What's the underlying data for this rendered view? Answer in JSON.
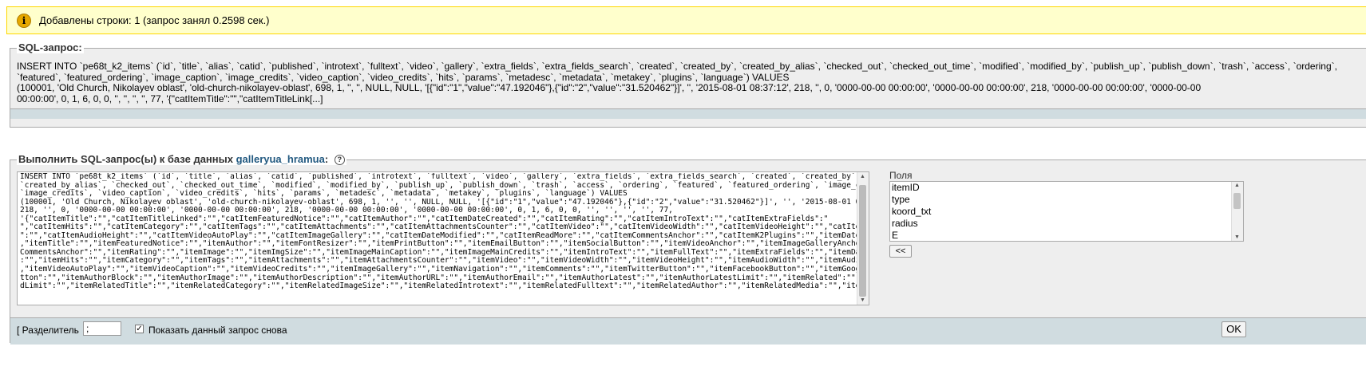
{
  "notice": {
    "icon": "info-icon",
    "icon_glyph": "i",
    "text": "Добавлены строки: 1 (запрос занял 0.2598 сек.)"
  },
  "sql_box": {
    "legend": "SQL-запрос:",
    "query": "INSERT INTO `pe68t_k2_items` (`id`, `title`, `alias`, `catid`, `published`, `introtext`, `fulltext`, `video`, `gallery`, `extra_fields`, `extra_fields_search`, `created`, `created_by`, `created_by_alias`, `checked_out`, `checked_out_time`, `modified`, `modified_by`, `publish_up`, `publish_down`, `trash`, `access`, `ordering`, `featured`, `featured_ordering`, `image_caption`, `image_credits`, `video_caption`, `video_credits`, `hits`, `params`, `metadesc`, `metadata`, `metakey`, `plugins`, `language`) VALUES\n(100001, 'Old Church, Nikolayev oblast', 'old-church-nikolayev-oblast', 698, 1, '', '', NULL, NULL, '[{\"id\":\"1\",\"value\":\"47.192046\"},{\"id\":\"2\",\"value\":\"31.520462\"}]', '', '2015-08-01 08:37:12', 218, '', 0, '0000-00-00 00:00:00', '0000-00-00 00:00:00', 218, '0000-00-00 00:00:00', '0000-00-00\n00:00:00', 0, 1, 6, 0, 0, '', '', '', '', 77, '{\"catItemTitle\":\"\",\"catItemTitleLink[...]"
  },
  "query_box": {
    "legend_prefix": "Выполнить SQL-запрос(ы) к базе данных ",
    "db_name": "galleryua_hramua",
    "legend_suffix": ":",
    "help_glyph": "?",
    "textarea_text": "INSERT INTO `pe68t_k2_items` (`id`, `title`, `alias`, `catid`, `published`, `introtext`, `fulltext`, `video`, `gallery`, `extra_fields`, `extra_fields_search`, `created`, `created_by`,\n`created_by_alias`, `checked_out`, `checked_out_time`, `modified`, `modified_by`, `publish_up`, `publish_down`, `trash`, `access`, `ordering`, `featured`, `featured_ordering`, `image_caption`,\n`image_credits`, `video_caption`, `video_credits`, `hits`, `params`, `metadesc`, `metadata`, `metakey`, `plugins`, `language`) VALUES\n(100001, 'Old Church, Nikolayev oblast', 'old-church-nikolayev-oblast', 698, 1, '', '', NULL, NULL, '[{\"id\":\"1\",\"value\":\"47.192046\"},{\"id\":\"2\",\"value\":\"31.520462\"}]', '', '2015-08-01 08:37:12',\n218, '', 0, '0000-00-00 00:00:00', '0000-00-00 00:00:00', 218, '0000-00-00 00:00:00', '0000-00-00 00:00:00', 0, 1, 6, 0, 0, '', '', '', '', 77,\n'{\"catItemTitle\":\"\",\"catItemTitleLinked\":\"\",\"catItemFeaturedNotice\":\"\",\"catItemAuthor\":\"\",\"catItemDateCreated\":\"\",\"catItemRating\":\"\",\"catItemIntroText\":\"\",\"catItemExtraFields\":\"\n\",\"catItemHits\":\"\",\"catItemCategory\":\"\",\"catItemTags\":\"\",\"catItemAttachments\":\"\",\"catItemAttachmentsCounter\":\"\",\"catItemVideo\":\"\",\"catItemVideoWidth\":\"\",\"catItemVideoHeight\":\"\",\"catItemAudioWidth\n\":\"\",\"catItemAudioHeight\":\"\",\"catItemVideoAutoPlay\":\"\",\"catItemImageGallery\":\"\",\"catItemDateModified\":\"\",\"catItemReadMore\":\"\",\"catItemCommentsAnchor\":\"\",\"catItemK2Plugins\":\"\",\"itemDateCreated\":\"\"\n,\"itemTitle\":\"\",\"itemFeaturedNotice\":\"\",\"itemAuthor\":\"\",\"itemFontResizer\":\"\",\"itemPrintButton\":\"\",\"itemEmailButton\":\"\",\"itemSocialButton\":\"\",\"itemVideoAnchor\":\"\",\"itemImageGalleryAnchor\":\"\",\"item\nCommentsAnchor\":\"\",\"itemRating\":\"\",\"itemImage\":\"\",\"itemImgSize\":\"\",\"itemImageMainCaption\":\"\",\"itemImageMainCredits\":\"\",\"itemIntroText\":\"\",\"itemFullText\":\"\",\"itemExtraFields\":\"\",\"itemDateModified\"\n:\"\",\"itemHits\":\"\",\"itemCategory\":\"\",\"itemTags\":\"\",\"itemAttachments\":\"\",\"itemAttachmentsCounter\":\"\",\"itemVideo\":\"\",\"itemVideoWidth\":\"\",\"itemVideoHeight\":\"\",\"itemAudioWidth\":\"\",\"itemAudioHeight\":\"\"\n,\"itemVideoAutoPlay\":\"\",\"itemVideoCaption\":\"\",\"itemVideoCredits\":\"\",\"itemImageGallery\":\"\",\"itemNavigation\":\"\",\"itemComments\":\"\",\"itemTwitterButton\":\"\",\"itemFacebookButton\":\"\",\"itemGooglePlusOneBu\ntton\":\"\",\"itemAuthorBlock\":\"\",\"itemAuthorImage\":\"\",\"itemAuthorDescription\":\"\",\"itemAuthorURL\":\"\",\"itemAuthorEmail\":\"\",\"itemAuthorLatest\":\"\",\"itemAuthorLatestLimit\":\"\",\"itemRelated\":\"\",\"itemRelate\ndLimit\":\"\",\"itemRelatedTitle\":\"\",\"itemRelatedCategory\":\"\",\"itemRelatedImageSize\":\"\",\"itemRelatedIntrotext\":\"\",\"itemRelatedFulltext\":\"\",\"itemRelatedAuthor\":\"\",\"itemRelatedMedia\":\"\",\"itemRelatedIma",
    "fields_label": "Поля",
    "fields": [
      "itemID",
      "type",
      "koord_txt",
      "radius",
      "E"
    ],
    "insert_button": "<<",
    "delimiter_label": "[ Разделитель",
    "delimiter_value": ";",
    "show_query_checked": true,
    "show_query_label": "Показать данный запрос снова",
    "ok_button": "OK"
  }
}
